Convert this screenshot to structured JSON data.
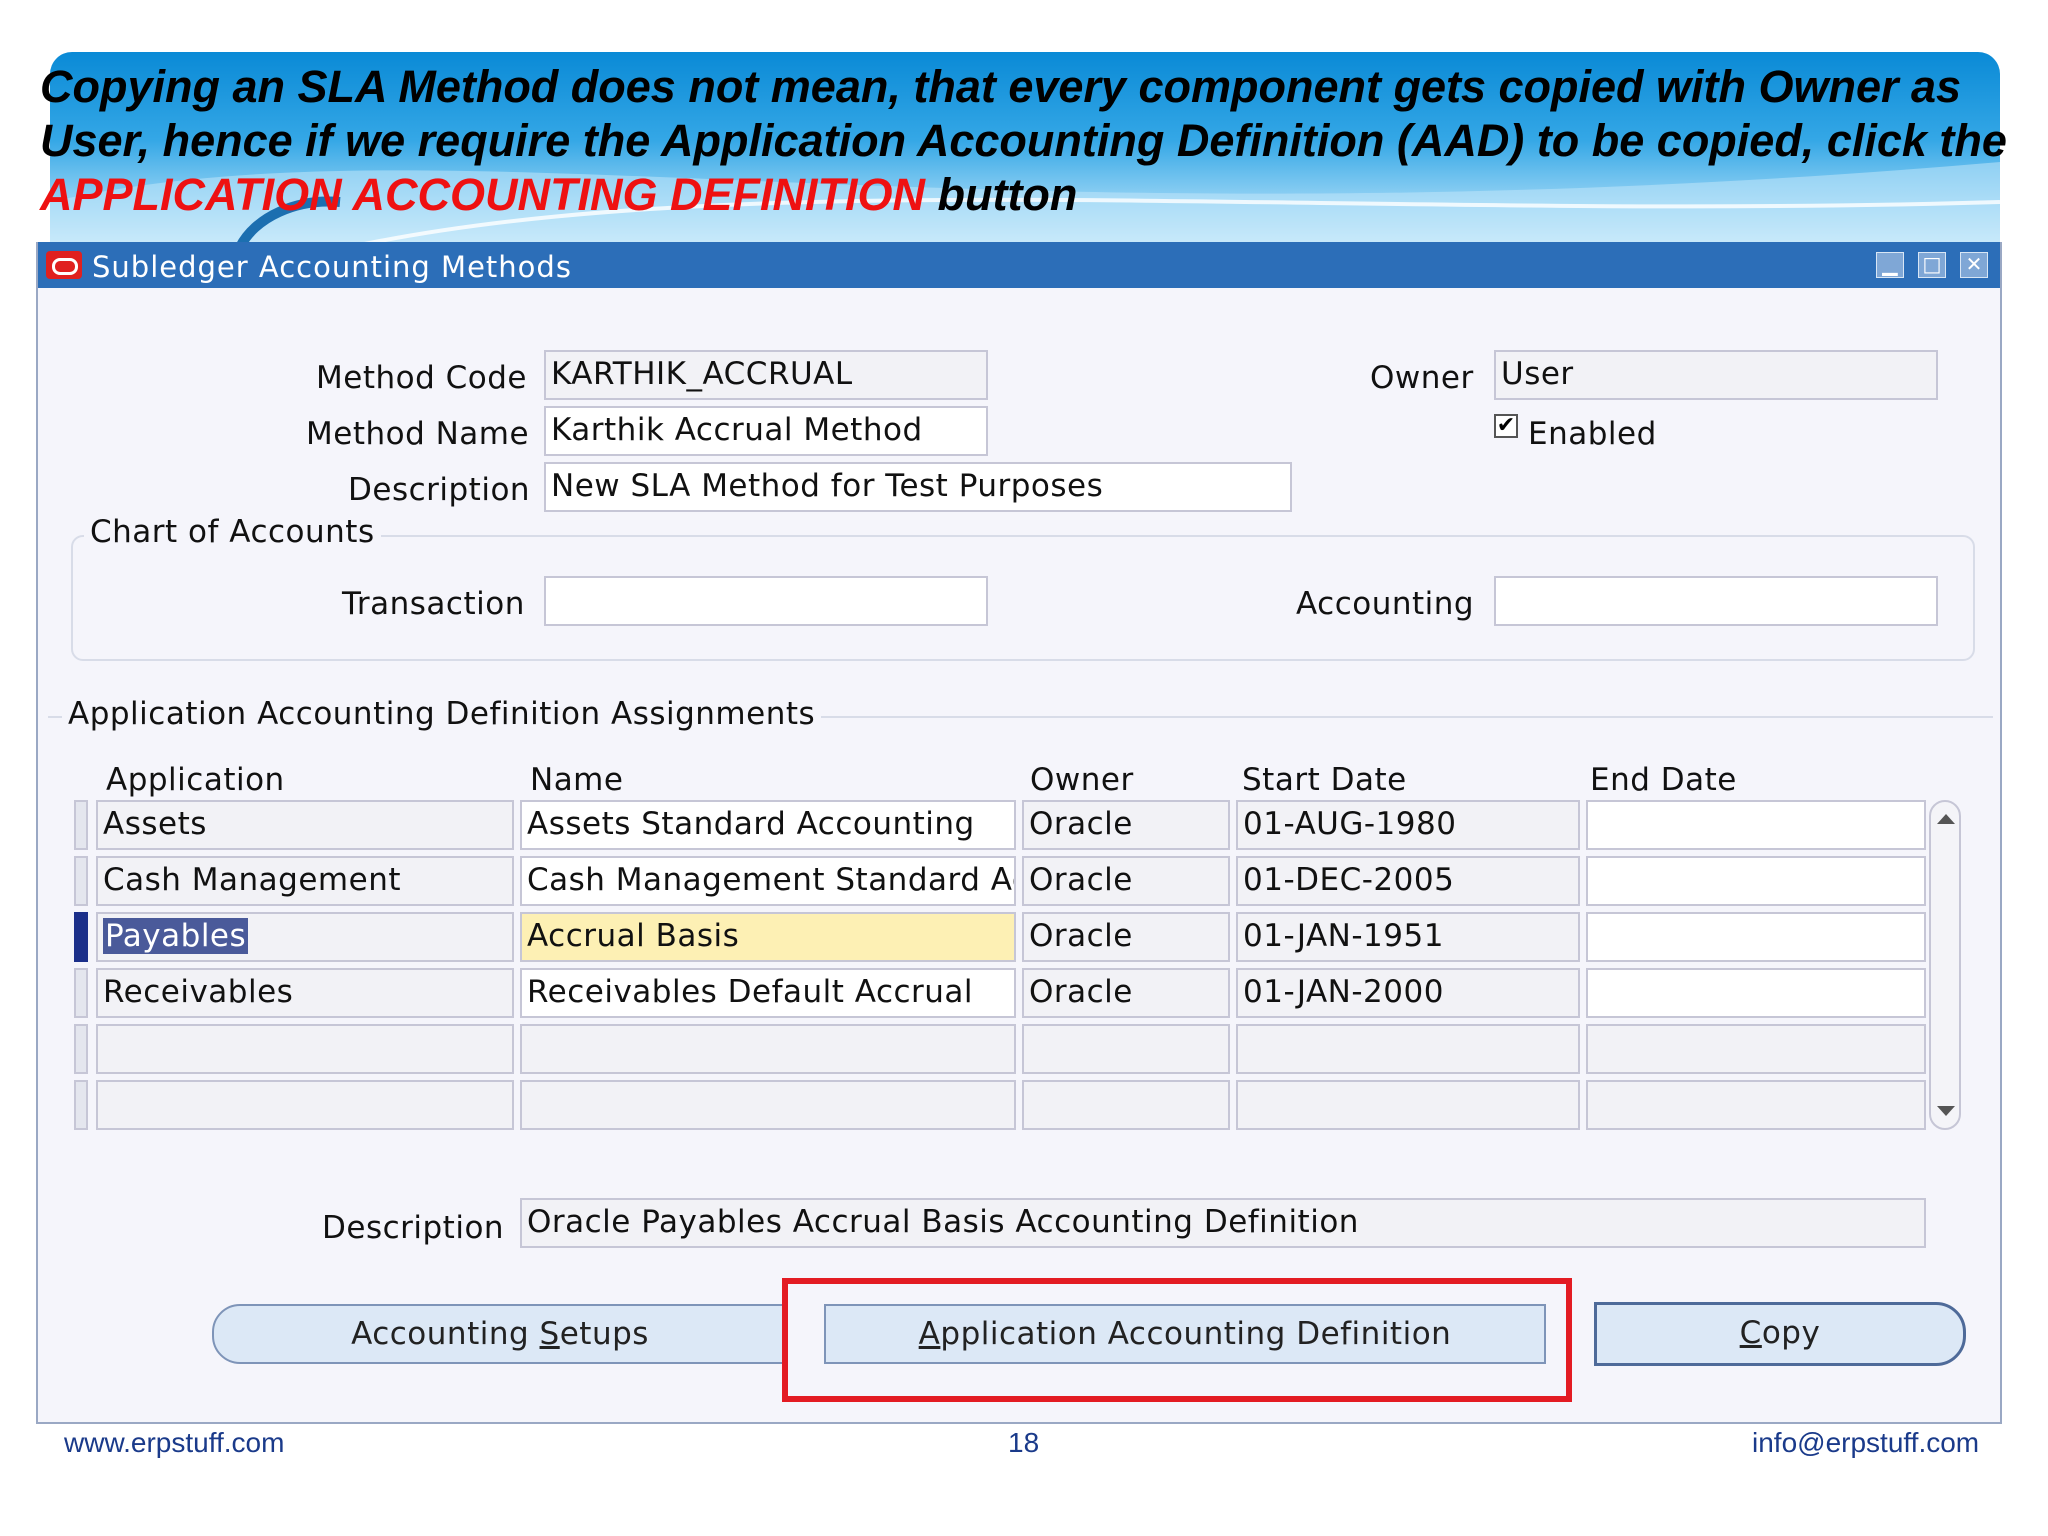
{
  "slide": {
    "title_prefix": "Copying an SLA Method does not mean, that every component gets copied with Owner as User, hence if we require the Application Accounting Definition (AAD) to be copied, click the ",
    "title_highlight": "APPLICATION ACCOUNTING DEFINITION",
    "title_suffix": " button",
    "highlight_color": "#ee1111"
  },
  "window": {
    "title": "Subledger Accounting Methods",
    "controls": [
      "minimize-icon",
      "maximize-icon",
      "close-icon"
    ]
  },
  "header": {
    "method_code_label": "Method Code",
    "method_code_value": "KARTHIK_ACCRUAL",
    "method_name_label": "Method Name",
    "method_name_value": "Karthik Accrual Method",
    "description_label": "Description",
    "description_value": "New SLA Method for Test Purposes",
    "owner_label": "Owner",
    "owner_value": "User",
    "enabled_label": "Enabled",
    "enabled_checked": true
  },
  "chart_of_accounts": {
    "group_label": "Chart of Accounts",
    "transaction_label": "Transaction",
    "transaction_value": "",
    "accounting_label": "Accounting",
    "accounting_value": ""
  },
  "assignments": {
    "group_label": "Application Accounting Definition Assignments",
    "columns": [
      "Application",
      "Name",
      "Owner",
      "Start Date",
      "End Date"
    ],
    "rows": [
      {
        "application": "Assets",
        "name": "Assets Standard Accounting",
        "owner": "Oracle",
        "start_date": "01-AUG-1980",
        "end_date": ""
      },
      {
        "application": "Cash Management",
        "name": "Cash Management Standard Acc",
        "owner": "Oracle",
        "start_date": "01-DEC-2005",
        "end_date": ""
      },
      {
        "application": "Payables",
        "name": "Accrual Basis",
        "owner": "Oracle",
        "start_date": "01-JAN-1951",
        "end_date": ""
      },
      {
        "application": "Receivables",
        "name": "Receivables Default Accrual",
        "owner": "Oracle",
        "start_date": "01-JAN-2000",
        "end_date": ""
      },
      {
        "application": "",
        "name": "",
        "owner": "",
        "start_date": "",
        "end_date": ""
      },
      {
        "application": "",
        "name": "",
        "owner": "",
        "start_date": "",
        "end_date": ""
      }
    ],
    "selected_row": 2,
    "description_label": "Description",
    "description_value": "Oracle Payables Accrual Basis Accounting Definition"
  },
  "buttons": {
    "accounting_setups_pre": "Accounting ",
    "accounting_setups_key": "S",
    "accounting_setups_post": "etups",
    "aad_key": "A",
    "aad_post": "pplication Accounting Definition",
    "copy_key": "C",
    "copy_post": "opy"
  },
  "footer": {
    "website": "www.erpstuff.com",
    "page_number": "18",
    "email": "info@erpstuff.com"
  }
}
